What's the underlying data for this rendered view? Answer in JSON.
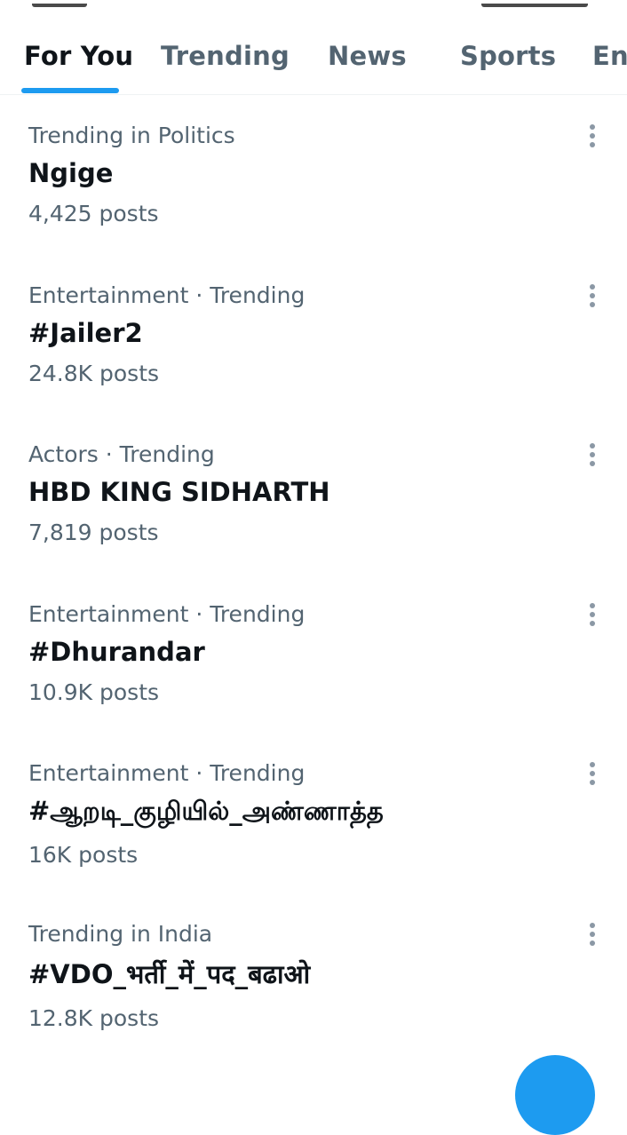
{
  "tabs": [
    {
      "label": "For You",
      "active": true
    },
    {
      "label": "Trending",
      "active": false
    },
    {
      "label": "News",
      "active": false
    },
    {
      "label": "Sports",
      "active": false
    },
    {
      "label": "Ent",
      "active": false
    }
  ],
  "trends": [
    {
      "context": "Trending in Politics",
      "topic": "Ngige",
      "count": "4,425 posts"
    },
    {
      "context": "Entertainment · Trending",
      "topic": "#Jailer2",
      "count": "24.8K posts"
    },
    {
      "context": "Actors · Trending",
      "topic": "HBD KING SIDHARTH",
      "count": "7,819 posts"
    },
    {
      "context": "Entertainment · Trending",
      "topic": "#Dhurandar",
      "count": "10.9K posts"
    },
    {
      "context": "Entertainment · Trending",
      "topic": "#ஆறடி_குழியில்_அண்ணாத்த",
      "count": "16K posts"
    },
    {
      "context": "Trending in India",
      "topic": "#VDO_भर्ती_में_पद_बढाओ",
      "count": "12.8K posts"
    }
  ],
  "icons": {
    "more": "more-vertical-icon",
    "compose": "compose-fab"
  },
  "colors": {
    "accent": "#1d9bf0",
    "text_primary": "#0f1419",
    "text_secondary": "#536471"
  }
}
